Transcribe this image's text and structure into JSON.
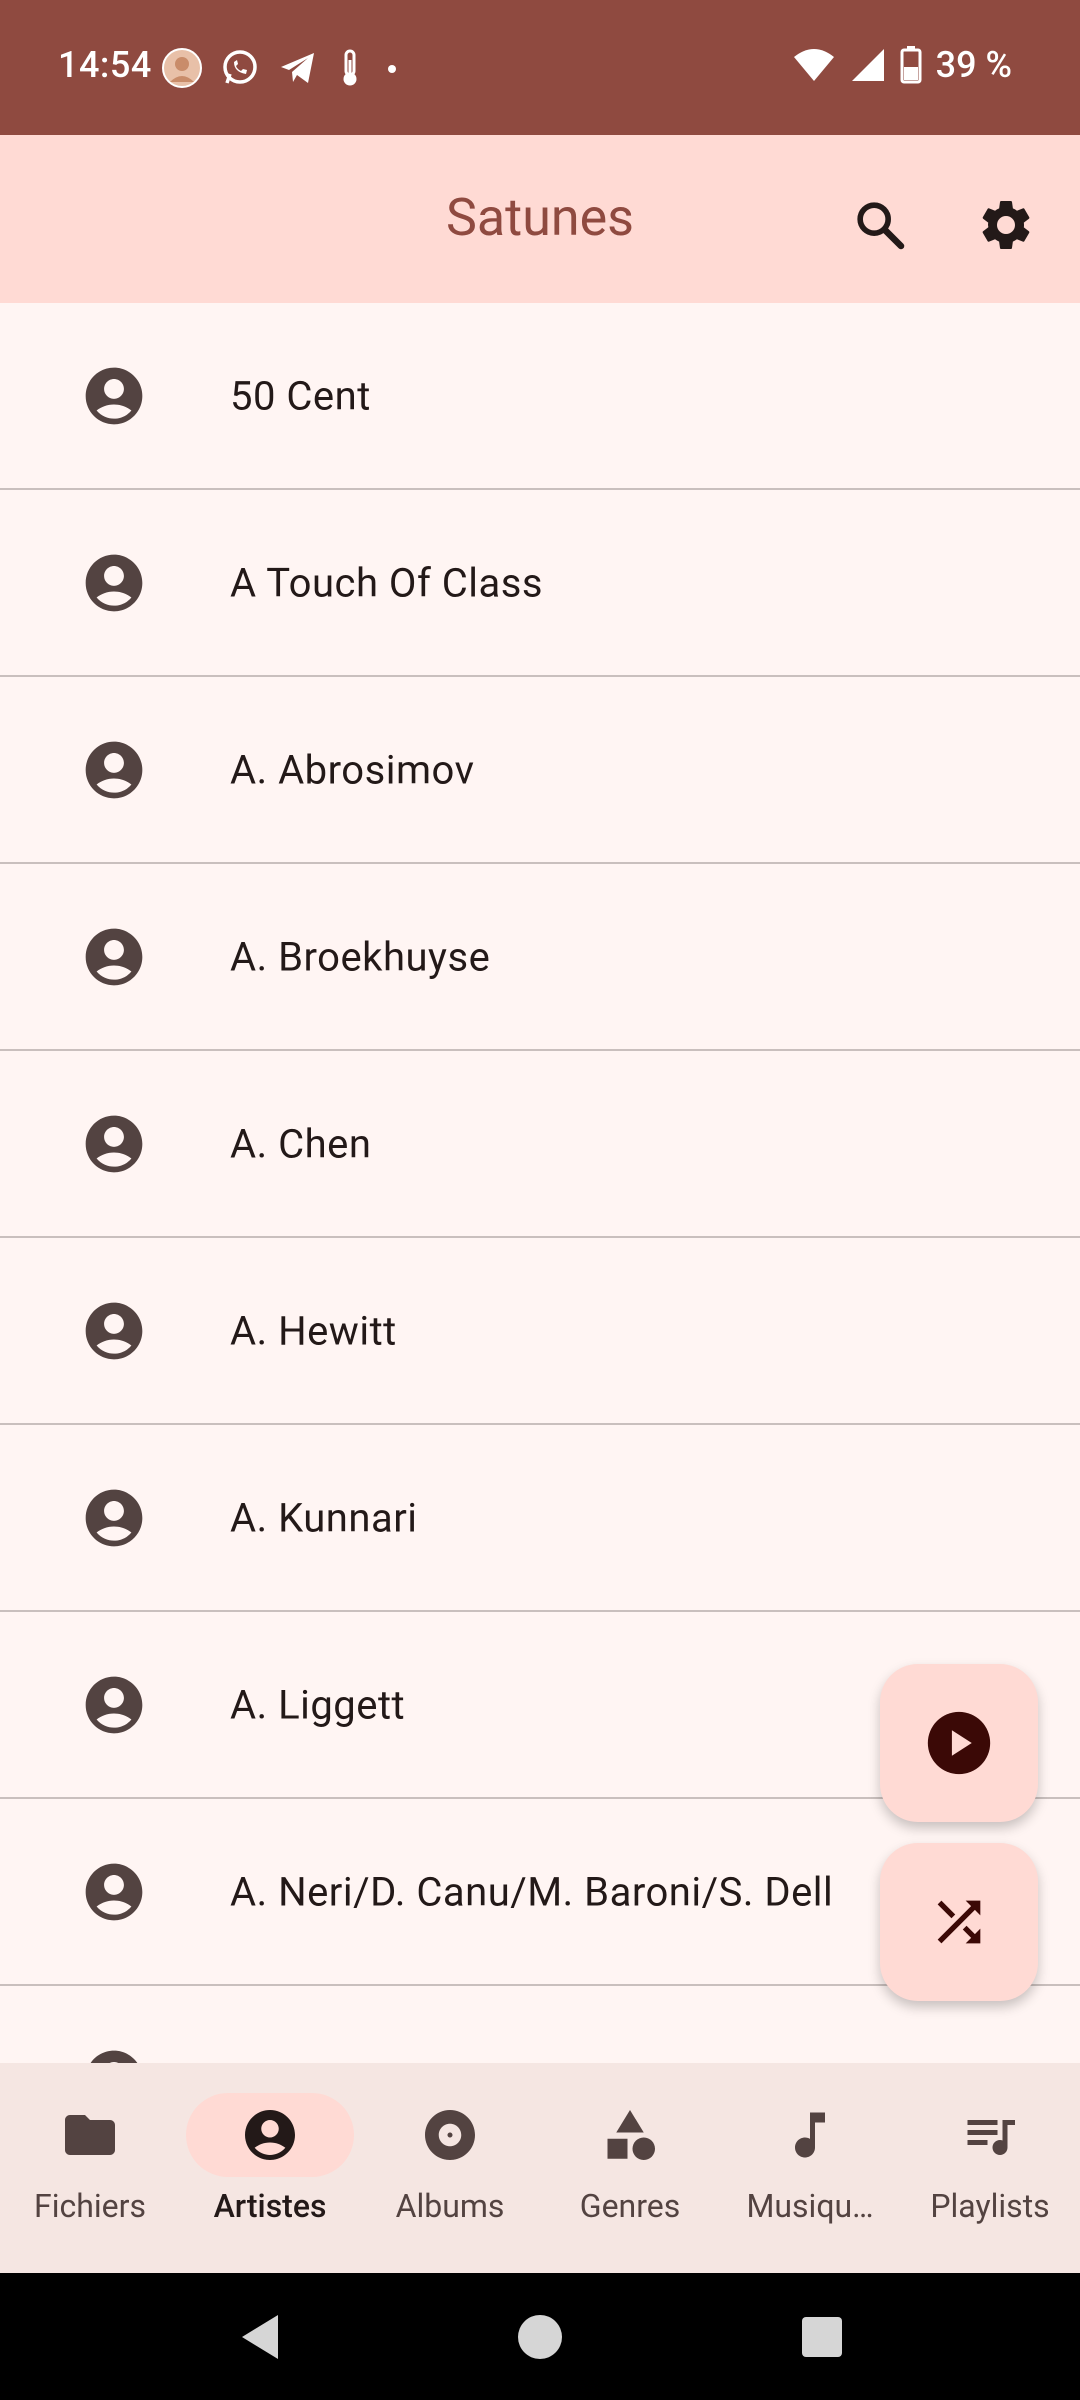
{
  "status_bar": {
    "time": "14:54",
    "notification_icons": [
      "avatar-icon",
      "whatsapp-icon",
      "telegram-icon",
      "thermometer-icon",
      "dot-icon"
    ],
    "battery_text": "39 %"
  },
  "app_bar": {
    "title": "Satunes",
    "search_icon": "search-icon",
    "settings_icon": "gear-icon"
  },
  "artists": [
    {
      "name": "50 Cent"
    },
    {
      "name": "A Touch Of Class"
    },
    {
      "name": "A. Abrosimov"
    },
    {
      "name": "A. Broekhuyse"
    },
    {
      "name": "A. Chen"
    },
    {
      "name": "A. Hewitt"
    },
    {
      "name": "A. Kunnari"
    },
    {
      "name": "A. Liggett"
    },
    {
      "name": "A. Neri/D. Canu/M. Baroni/S. Dell"
    },
    {
      "name": ""
    }
  ],
  "fabs": {
    "play_icon": "play-icon",
    "shuffle_icon": "shuffle-icon"
  },
  "bottom_nav": {
    "items": [
      {
        "label": "Fichiers",
        "icon": "folder-icon"
      },
      {
        "label": "Artistes",
        "icon": "person-icon",
        "active": true
      },
      {
        "label": "Albums",
        "icon": "album-icon"
      },
      {
        "label": "Genres",
        "icon": "shapes-icon"
      },
      {
        "label": "Musiqu…",
        "icon": "music-note-icon"
      },
      {
        "label": "Playlists",
        "icon": "playlist-icon"
      }
    ]
  },
  "colors": {
    "status_bar": "#8f4a40",
    "app_bar": "#ffdad4",
    "background": "#fff5f3",
    "title": "#8f4a40",
    "icon": "#534341",
    "divider": "#c9bfbd"
  }
}
